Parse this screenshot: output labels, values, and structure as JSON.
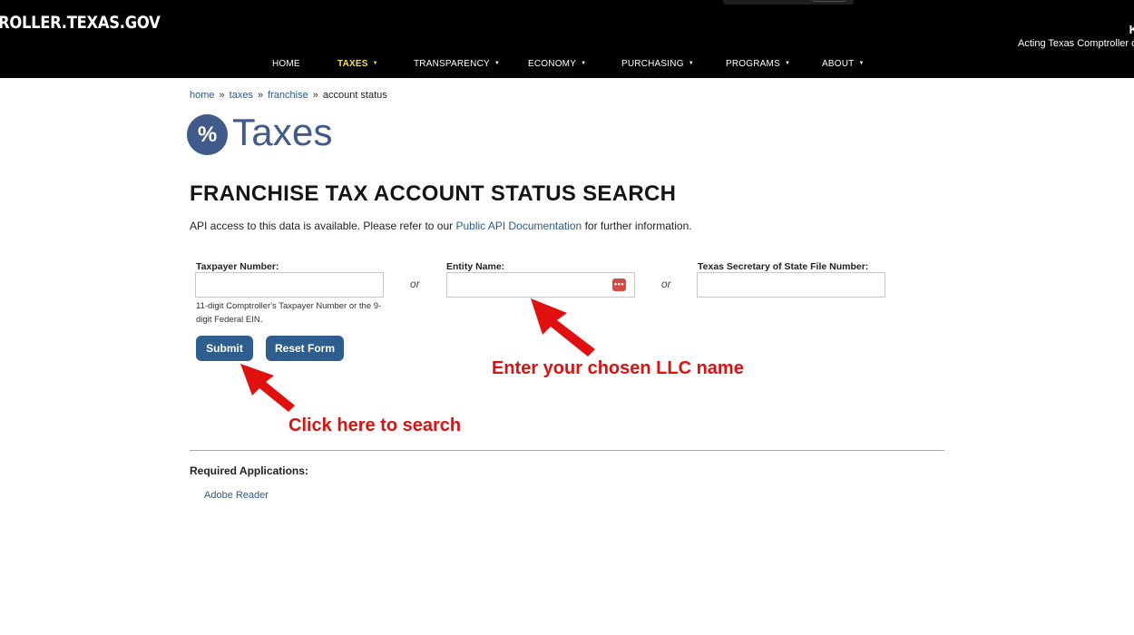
{
  "header": {
    "site_name": "ROLLER.TEXAS.GOV",
    "comptroller_name": "K",
    "comptroller_title": "Acting Texas Comptroller o"
  },
  "nav": {
    "items": [
      {
        "label": "HOME",
        "has_menu": false
      },
      {
        "label": "TAXES",
        "has_menu": true,
        "active": true
      },
      {
        "label": "TRANSPARENCY",
        "has_menu": true
      },
      {
        "label": "ECONOMY",
        "has_menu": true
      },
      {
        "label": "PURCHASING",
        "has_menu": true
      },
      {
        "label": "PROGRAMS",
        "has_menu": true
      },
      {
        "label": "ABOUT",
        "has_menu": true
      }
    ],
    "menu_glyph": "▼",
    "active_color": "#f2e24b"
  },
  "breadcrumb": {
    "items": [
      "home",
      "taxes",
      "franchise",
      "account status"
    ],
    "separator": "»"
  },
  "section": {
    "badge": "%",
    "title": "Taxes",
    "color": "#3f5a8b"
  },
  "page": {
    "title": "FRANCHISE TAX ACCOUNT STATUS SEARCH",
    "intro_before": "API access to this data is available. Please refer to our ",
    "intro_link": "Public API Documentation",
    "intro_after": " for further information."
  },
  "form": {
    "taxpayer_label": "Taxpayer Number:",
    "taxpayer_value": "",
    "taxpayer_help": "11-digit Comptroller's Taxpayer Number or the 9-digit Federal EIN.",
    "or_text": "or",
    "entity_label": "Entity Name:",
    "entity_value": "",
    "autofill_icon": "password-manager-icon",
    "sos_label": "Texas Secretary of State File Number:",
    "sos_value": "",
    "submit_label": "Submit",
    "reset_label": "Reset Form",
    "button_color": "#2e5e8e"
  },
  "annotations": {
    "entity_note": "Enter your chosen LLC name",
    "submit_note": "Click here to search",
    "color": "#e0100f"
  },
  "footer": {
    "required_heading": "Required Applications:",
    "required_link": "Adobe Reader"
  }
}
